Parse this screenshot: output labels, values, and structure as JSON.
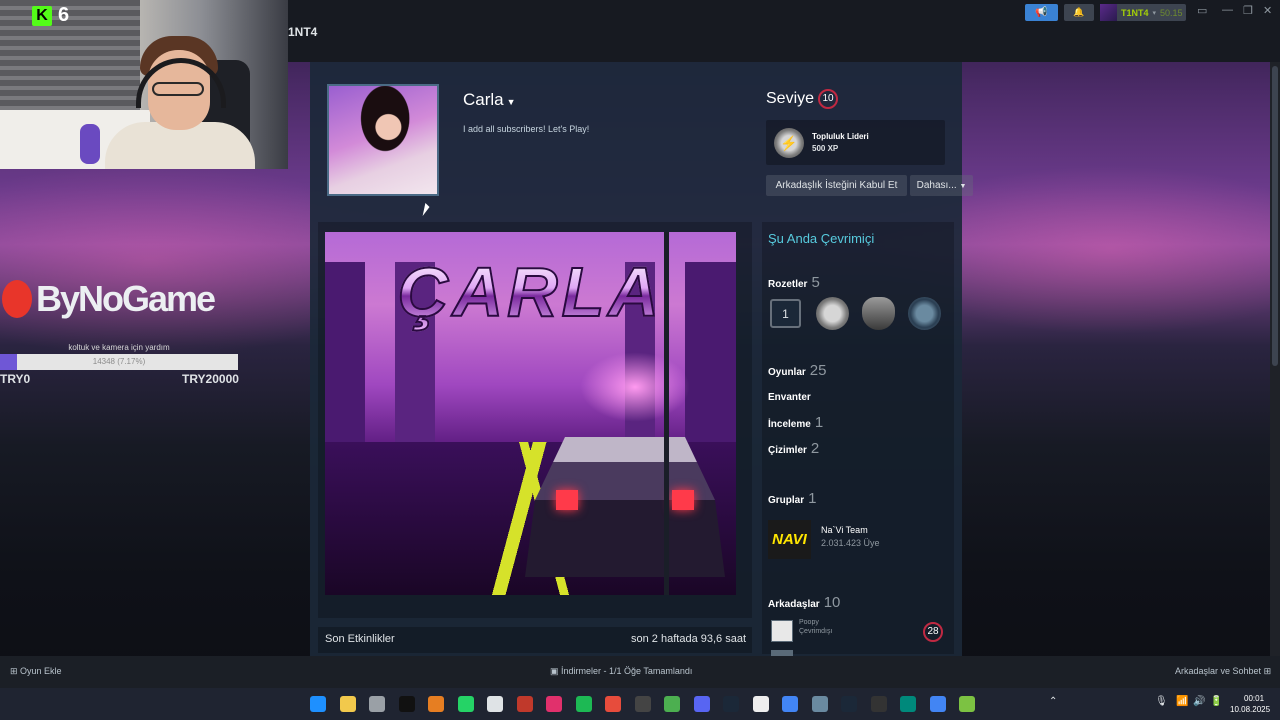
{
  "stream_overlay": {
    "viewer_count": "6",
    "sponsor_brand": "ByNoGame",
    "donation_goal": {
      "caption": "koltuk ve kamera için yardım",
      "progress_text": "14348 (7.17%)",
      "progress_fraction": 0.0717,
      "min_label": "TRY0",
      "max_label": "TRY20000"
    }
  },
  "steam_header": {
    "tab_name": "1NT4",
    "user": {
      "name": "T1NT4",
      "balance": "50.15"
    }
  },
  "profile": {
    "name": "Carla",
    "summary": "I add all subscribers! Let's Play!",
    "level_label": "Seviye",
    "level": "10",
    "favorite_badge": {
      "title": "Topluluk Lideri",
      "xp": "500 XP"
    },
    "accept_friend_button": "Arkadaşlık İsteğini Kabul Et",
    "more_button": "Dahası...",
    "artwork_title": "ÇARLA",
    "status": "Şu Anda Çevrimiçi",
    "badges": {
      "label": "Rozetler",
      "count": "5",
      "first_badge_value": "1"
    },
    "games": {
      "label": "Oyunlar",
      "count": "25"
    },
    "inventory_label": "Envanter",
    "reviews": {
      "label": "İnceleme",
      "count": "1"
    },
    "artworks": {
      "label": "Çizimler",
      "count": "2"
    },
    "groups": {
      "label": "Gruplar",
      "count": "1"
    },
    "group": {
      "logo_text": "NAVI",
      "name": "Na`Vi Team",
      "members": "2.031.423 Üye"
    },
    "friends": {
      "label": "Arkadaşlar",
      "count": "10"
    },
    "friend": {
      "name": "Poopy",
      "status": "Çevrimdışı",
      "level": "28"
    },
    "recent_activity_label": "Son Etkinlikler",
    "recent_activity_summary": "son 2 haftada 93,6 saat"
  },
  "steam_footer": {
    "add_game": "Oyun Ekle",
    "downloads": "İndirmeler - 1/1 Öğe Tamamlandı",
    "friends_chat": "Arkadaşlar ve Sohbet"
  },
  "taskbar": {
    "time": "00:01",
    "date": "10.08.2025",
    "icons": [
      "windows-start-icon",
      "store-icon",
      "settings-icon",
      "tiktok-icon",
      "cloud-icon",
      "whatsapp-icon",
      "headphones-icon",
      "app-icon",
      "instagram-icon",
      "spotify-icon",
      "chat-icon",
      "epic-icon",
      "minecraft-icon",
      "discord-icon",
      "steam-icon",
      "tw-icon",
      "chrome-icon",
      "app2-icon",
      "steam2-icon",
      "obs-icon",
      "meet-icon",
      "chrome2-icon",
      "play-icon"
    ]
  },
  "colors": {
    "accent_blue": "#57cbde",
    "level_red": "#c02942",
    "steam_dark": "#171a21",
    "taskbar": "#1f2431"
  }
}
